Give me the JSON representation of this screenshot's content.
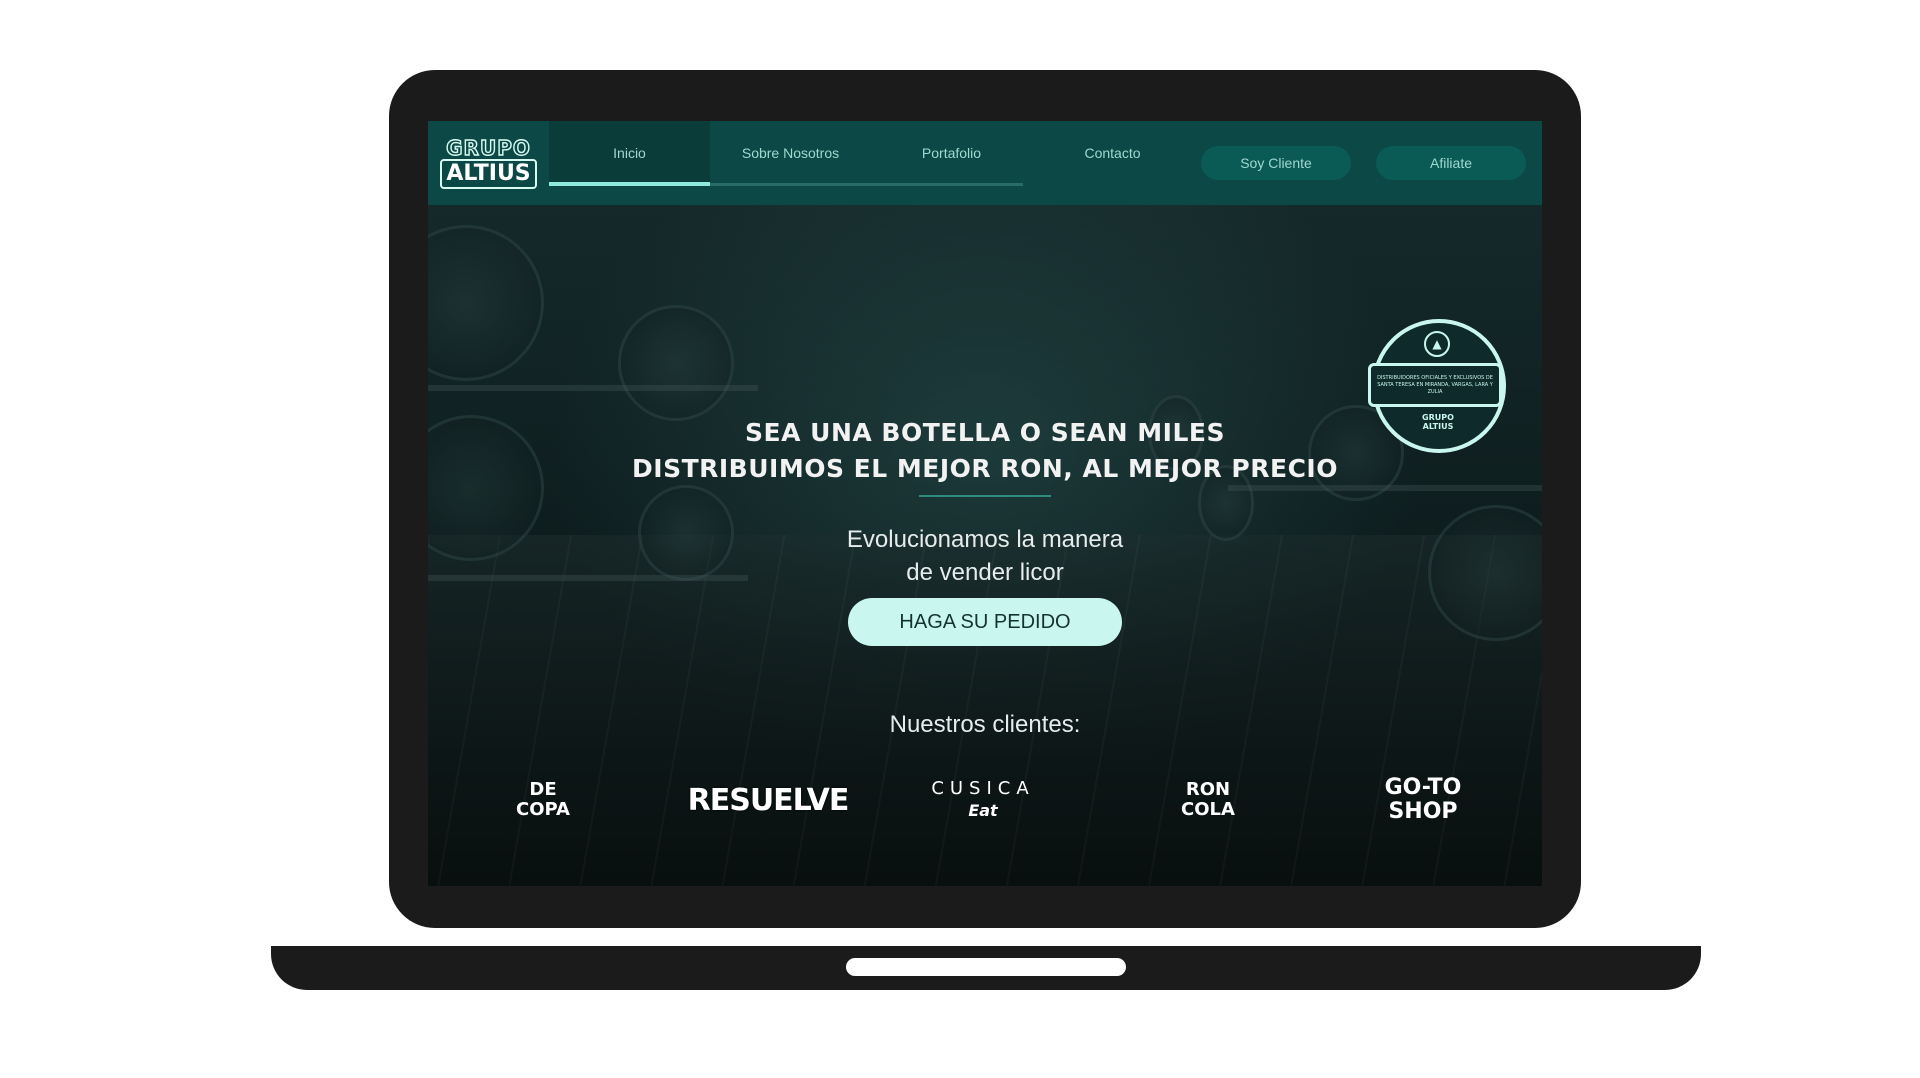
{
  "brand": {
    "logo_line1": "GRUPO",
    "logo_line2": "ALTIUS"
  },
  "nav": {
    "links": [
      {
        "label": "Inicio",
        "active": true
      },
      {
        "label": "Sobre Nosotros",
        "active": false
      },
      {
        "label": "Portafolio",
        "active": false
      },
      {
        "label": "Contacto",
        "active": false
      }
    ],
    "buttons": [
      {
        "label": "Soy Cliente"
      },
      {
        "label": "Afiliate"
      }
    ]
  },
  "hero": {
    "headline_line1": "SEA UNA BOTELLA O SEAN MILES",
    "headline_line2": "DISTRIBUIMOS EL MEJOR RON, AL MEJOR PRECIO",
    "subhead_line1": "Evolucionamos la manera",
    "subhead_line2": "de vender licor",
    "cta_label": "HAGA SU PEDIDO"
  },
  "badge": {
    "text": "DISTRIBUIDORES OFICIALES Y EXCLUSIVOS DE SANTA TERESA EN MIRANDA, VARGAS, LARA Y ZULIA",
    "logo_line1": "GRUPO",
    "logo_line2": "ALTIUS"
  },
  "clients": {
    "title": "Nuestros clientes:",
    "logos": [
      {
        "line1": "DE",
        "line2": "COPA"
      },
      {
        "line1": "RESUELVE",
        "line2": ""
      },
      {
        "line1": "CUSICA",
        "line2": "Eat"
      },
      {
        "line1": "RON",
        "line2": "COLA"
      },
      {
        "line1": "GO-TO",
        "line2": "SHOP"
      }
    ]
  },
  "colors": {
    "nav_bg": "#0c4845",
    "accent": "#c9f7ef",
    "laptop": "#1b1b1b"
  }
}
